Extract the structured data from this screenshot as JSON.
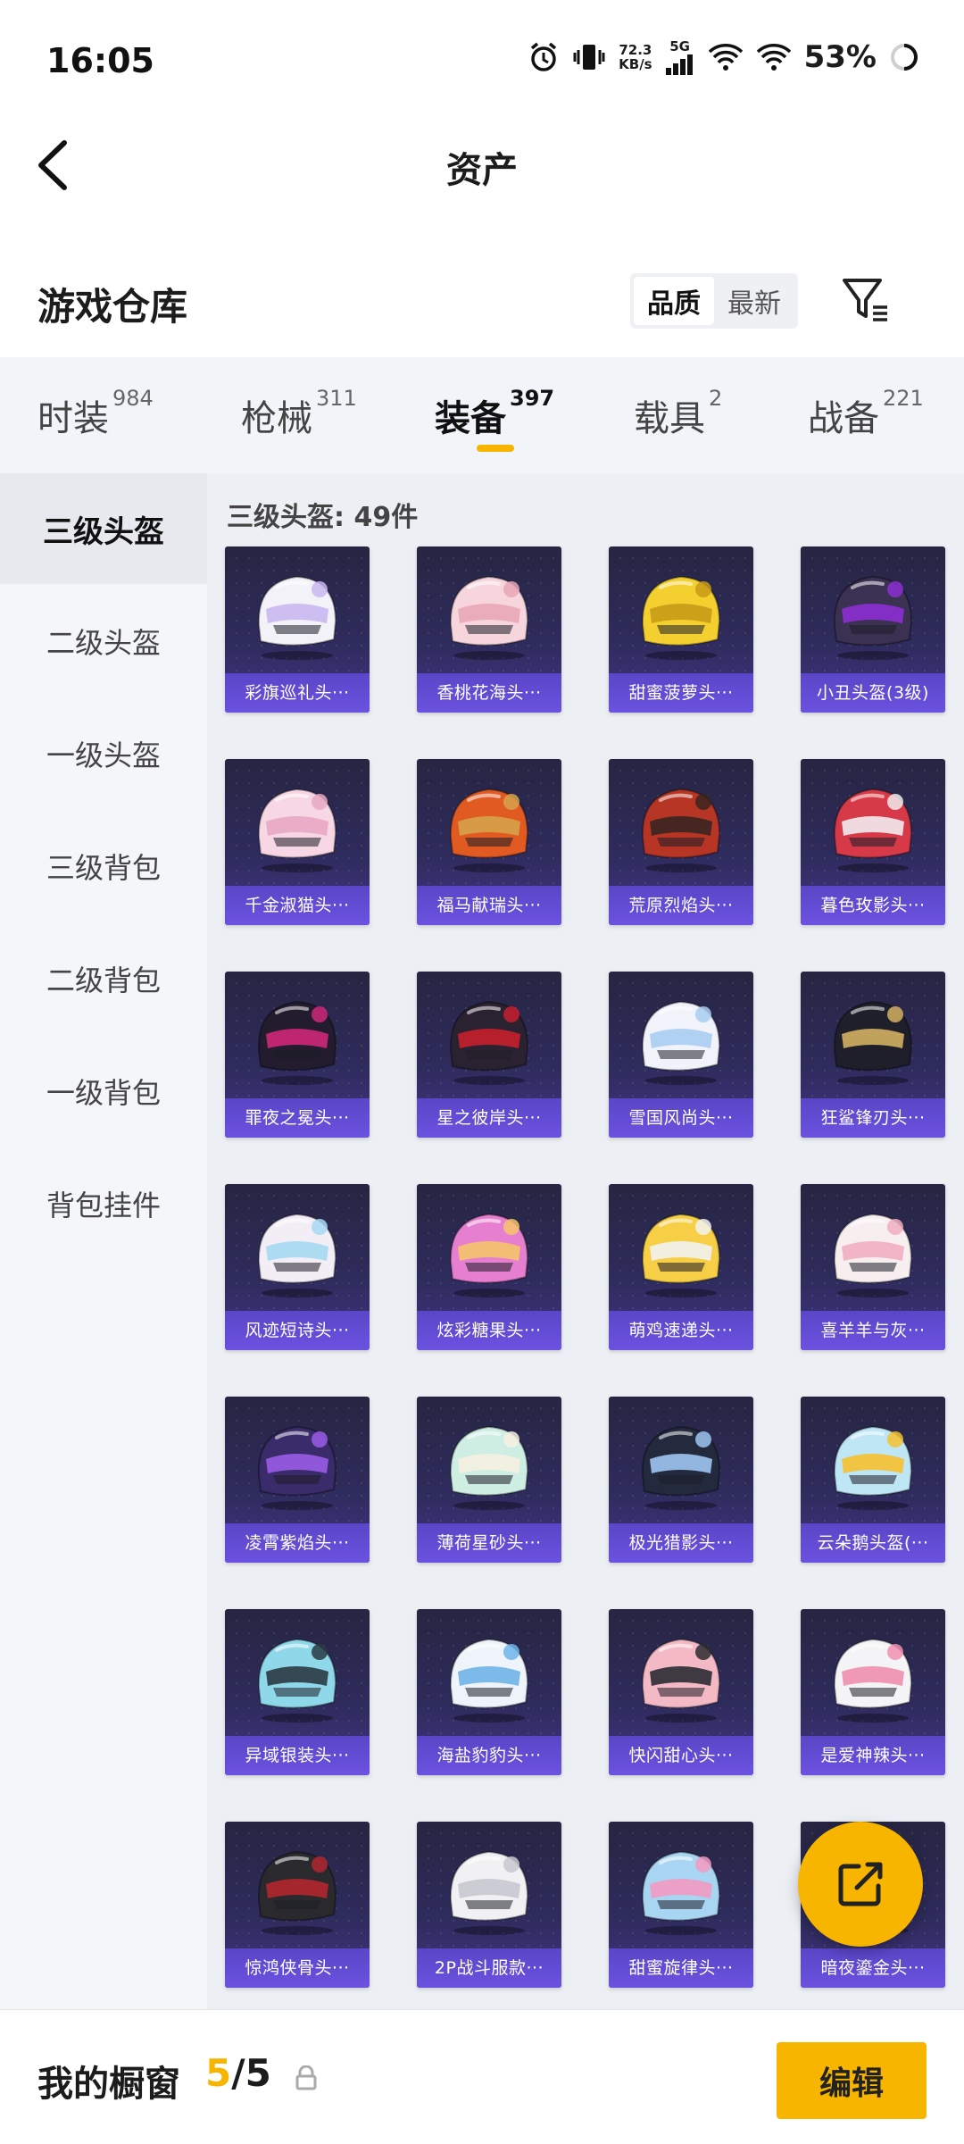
{
  "status_bar": {
    "time": "16:05",
    "net_speed": "72.3",
    "net_unit": "KB/s",
    "network": "5G",
    "battery": "53%"
  },
  "header": {
    "title": "资产"
  },
  "warehouse": {
    "title": "游戏仓库",
    "sort_options": [
      "品质",
      "最新"
    ],
    "sort_selected": "品质"
  },
  "tabs": [
    {
      "label": "时装",
      "count": "984"
    },
    {
      "label": "枪械",
      "count": "311"
    },
    {
      "label": "装备",
      "count": "397",
      "active": true
    },
    {
      "label": "载具",
      "count": "2"
    },
    {
      "label": "战备",
      "count": "221"
    }
  ],
  "sidebar": {
    "items": [
      {
        "label": "三级头盔",
        "active": true
      },
      {
        "label": "二级头盔"
      },
      {
        "label": "一级头盔"
      },
      {
        "label": "三级背包"
      },
      {
        "label": "二级背包"
      },
      {
        "label": "一级背包"
      },
      {
        "label": "背包挂件"
      }
    ]
  },
  "content": {
    "count_text": "三级头盔: 49件",
    "items": [
      {
        "name": "彩旗巡礼头···",
        "colors": [
          "#f2f2f8",
          "#c9b7f0"
        ]
      },
      {
        "name": "香桃花海头···",
        "colors": [
          "#f6d6dc",
          "#e9a6b6"
        ]
      },
      {
        "name": "甜蜜菠萝头···",
        "colors": [
          "#f3d02f",
          "#c99a18"
        ]
      },
      {
        "name": "小丑头盔(3级)",
        "colors": [
          "#3b3152",
          "#8c2fd0"
        ]
      },
      {
        "name": "千金淑猫头···",
        "colors": [
          "#f7d7e3",
          "#e8a9c4"
        ]
      },
      {
        "name": "福马献瑞头···",
        "colors": [
          "#e05a22",
          "#d6a24a"
        ]
      },
      {
        "name": "荒原烈焰头···",
        "colors": [
          "#b73524",
          "#3a2520"
        ]
      },
      {
        "name": "暮色玫影头···",
        "colors": [
          "#d63a48",
          "#f2ecef"
        ]
      },
      {
        "name": "罪夜之冕头···",
        "colors": [
          "#221c2e",
          "#d0287a"
        ]
      },
      {
        "name": "星之彼岸头···",
        "colors": [
          "#2a2230",
          "#c81f2e"
        ]
      },
      {
        "name": "雪国风尚头···",
        "colors": [
          "#f1f3fb",
          "#a8cdf0"
        ]
      },
      {
        "name": "狂鲨锋刃头···",
        "colors": [
          "#1e1f2b",
          "#d3b062"
        ]
      },
      {
        "name": "风迹短诗头···",
        "colors": [
          "#f3eef6",
          "#a4d8f2"
        ]
      },
      {
        "name": "炫彩糖果头···",
        "colors": [
          "#e67fcf",
          "#f5c46a"
        ]
      },
      {
        "name": "萌鸡速递头···",
        "colors": [
          "#f6cf46",
          "#f2f2f2"
        ]
      },
      {
        "name": "喜羊羊与灰···",
        "colors": [
          "#f7eef0",
          "#f0aec0"
        ]
      },
      {
        "name": "凌霄紫焰头···",
        "colors": [
          "#3a2c6a",
          "#9b5ce8"
        ]
      },
      {
        "name": "薄荷星砂头···",
        "colors": [
          "#cfeee3",
          "#f4f0e0"
        ]
      },
      {
        "name": "极光猎影头···",
        "colors": [
          "#242a3e",
          "#9fc5f2"
        ]
      },
      {
        "name": "云朵鹅头盔(···",
        "colors": [
          "#bfe6f5",
          "#f6c030"
        ]
      },
      {
        "name": "异域银装头···",
        "colors": [
          "#8fd8ea",
          "#2a3a44"
        ]
      },
      {
        "name": "海盐豹豹头···",
        "colors": [
          "#eef4fa",
          "#6fb4e8"
        ]
      },
      {
        "name": "快闪甜心头···",
        "colors": [
          "#f3b9c4",
          "#2b2b33"
        ]
      },
      {
        "name": "是爱神辣头···",
        "colors": [
          "#f4f4f6",
          "#f08fb0"
        ]
      },
      {
        "name": "惊鸿侠骨头···",
        "colors": [
          "#2a2a2e",
          "#b3262e"
        ]
      },
      {
        "name": "2P战斗服款···",
        "colors": [
          "#f1f1f3",
          "#c8c8d0"
        ]
      },
      {
        "name": "甜蜜旋律头···",
        "colors": [
          "#a8d6f2",
          "#f29ac2"
        ]
      },
      {
        "name": "暗夜鎏金头···",
        "colors": [
          "#24222c",
          "#c9a24a"
        ]
      }
    ]
  },
  "bottom_bar": {
    "label": "我的橱窗",
    "current": "5",
    "total": "/5",
    "edit_label": "编辑"
  },
  "theme": {
    "accent": "#f7b500",
    "card_label": "#6b52e0"
  }
}
